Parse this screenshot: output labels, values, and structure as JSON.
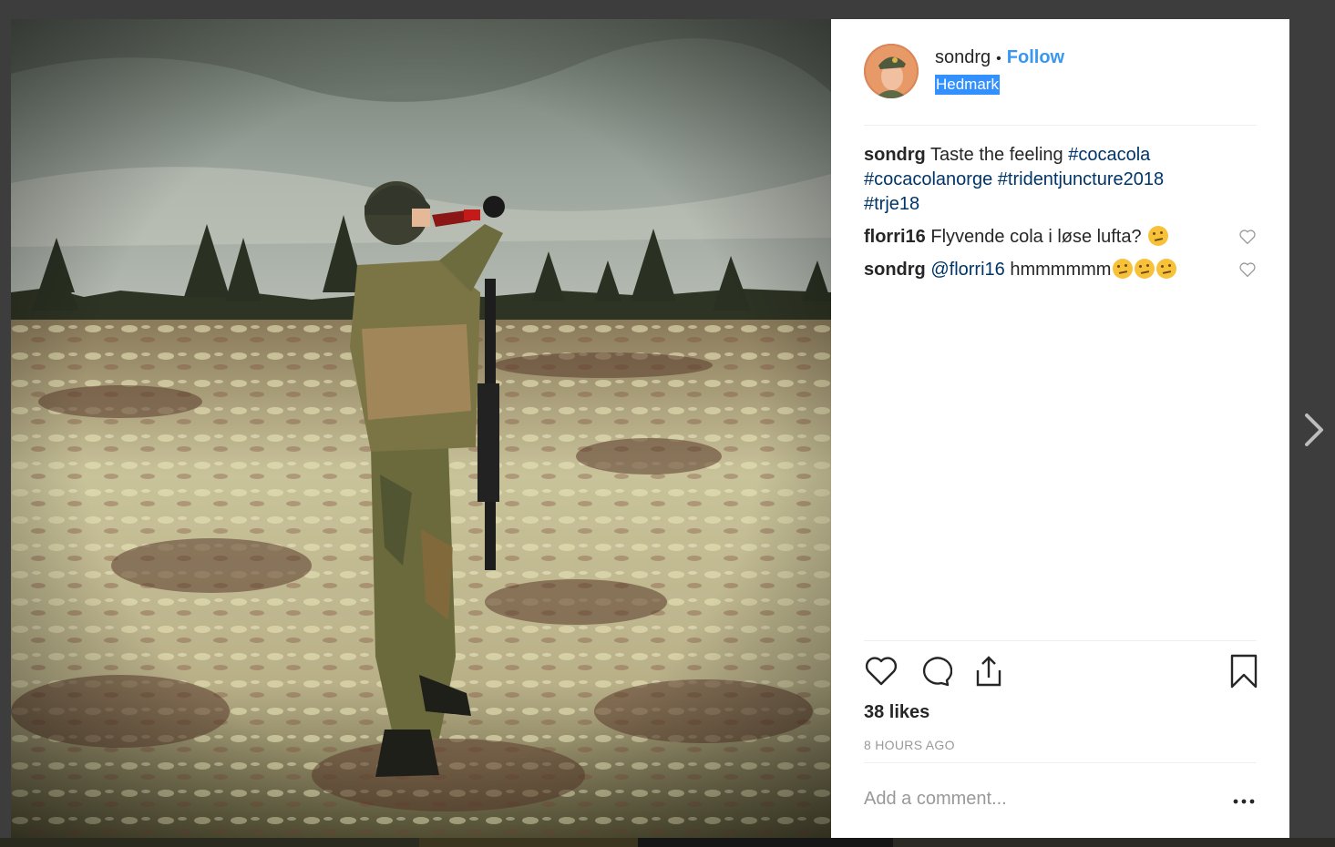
{
  "post": {
    "username": "sondrg",
    "follow_label": "Follow",
    "separator": "•",
    "location": "Hedmark",
    "caption": {
      "user": "sondrg",
      "text": "Taste the feeling",
      "hashtags": [
        "#cocacola",
        "#cocacolanorge",
        "#tridentjuncture2018",
        "#trje18"
      ]
    },
    "comments": [
      {
        "user": "florri16",
        "text": "Flyvende cola i løse lufta?",
        "emoji_count": 1
      },
      {
        "user": "sondrg",
        "mention": "@florri16",
        "text": "hmmmmmm",
        "emoji_count": 3
      }
    ],
    "likes": "38 likes",
    "time": "8 HOURS AGO",
    "comment_placeholder": "Add a comment..."
  },
  "icons": {
    "like": "heart-icon",
    "comment": "speech-bubble-icon",
    "share": "share-icon",
    "save": "bookmark-icon",
    "more": "ellipsis-icon",
    "next": "chevron-right-icon",
    "emoji": "thinking-face-emoji"
  },
  "colors": {
    "link": "#3897f0",
    "hashtag": "#003569",
    "selection": "#3390ff",
    "text": "#262626",
    "muted": "#999999"
  }
}
